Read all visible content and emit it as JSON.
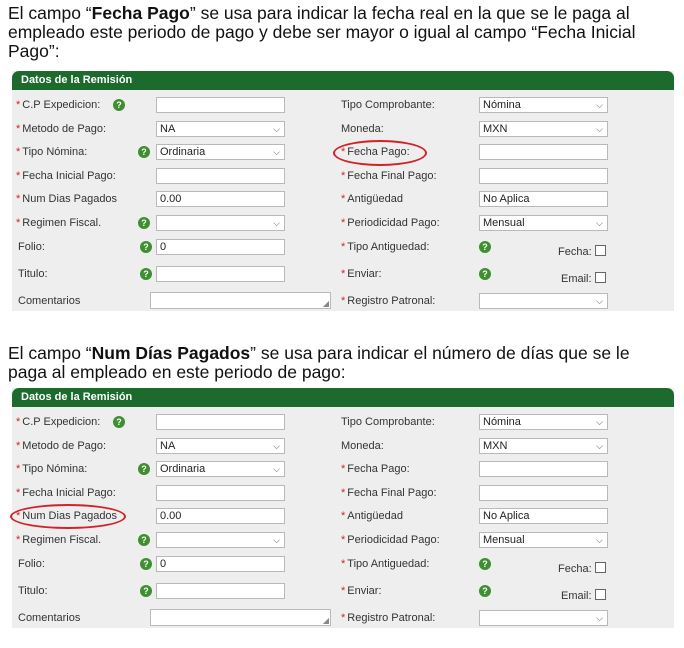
{
  "intro1": {
    "line1_pre": "El campo “",
    "line1_bold": "Fecha Pago",
    "line1_post": "” se usa para indicar la fecha real en la que se le paga al",
    "line2": "empleado este periodo de pago y debe ser mayor o igual al campo “Fecha Inicial",
    "line3": "Pago”:"
  },
  "intro2": {
    "line1_pre": "El campo “",
    "line1_bold": "Num Días Pagados",
    "line1_post": "” se usa para indicar el número de días que se le",
    "line2": "paga al empleado en este periodo de pago:"
  },
  "form": {
    "header": "Datos de la Remisión",
    "required_mark": "*",
    "help_icon": "?",
    "select_arrow": "⌵",
    "resize_grip": "◢",
    "labels": {
      "cp_expedicion": "C.P Expedicion:",
      "metodo_pago": "Metodo de Pago:",
      "tipo_nomina": "Tipo Nómina:",
      "fecha_inicial_pago": "Fecha Inicial Pago:",
      "num_dias_pagados": "Num Dias Pagados",
      "regimen_fiscal": "Regimen Fiscal.",
      "folio": "Folio:",
      "titulo": "Titulo:",
      "comentarios": "Comentarios",
      "tipo_comprobante": "Tipo Comprobante:",
      "moneda": "Moneda:",
      "fecha_pago": "Fecha Pago:",
      "fecha_final_pago": "Fecha Final Pago:",
      "antiguedad": "Antigüedad",
      "periodicidad_pago": "Periodicidad Pago:",
      "tipo_antiguedad": "Tipo Antiguedad:",
      "enviar": "Enviar:",
      "registro_patronal": "Registro Patronal:",
      "fecha_chk": "Fecha:",
      "email_chk": "Email:"
    },
    "values": {
      "cp_expedicion": "",
      "metodo_pago": "NA",
      "tipo_nomina": "Ordinaria",
      "fecha_inicial_pago": "",
      "num_dias_pagados": "0.00",
      "regimen_fiscal": "",
      "folio": "0",
      "titulo": "",
      "comentarios": "",
      "tipo_comprobante": "Nómina",
      "moneda": "MXN",
      "fecha_pago": "",
      "fecha_final_pago": "",
      "antiguedad": "No Aplica",
      "periodicidad_pago": "Mensual",
      "registro_patronal": "",
      "fecha_checked": false,
      "email_checked": false
    }
  },
  "highlights": {
    "panel1": "fecha_pago",
    "panel2": "num_dias_pagados",
    "color": "#d0232a"
  },
  "colors": {
    "header_bg": "#1d6b2c",
    "panel_bg": "#eeeeee",
    "required": "#d0232a",
    "help_icon": "#3d8f2f"
  }
}
